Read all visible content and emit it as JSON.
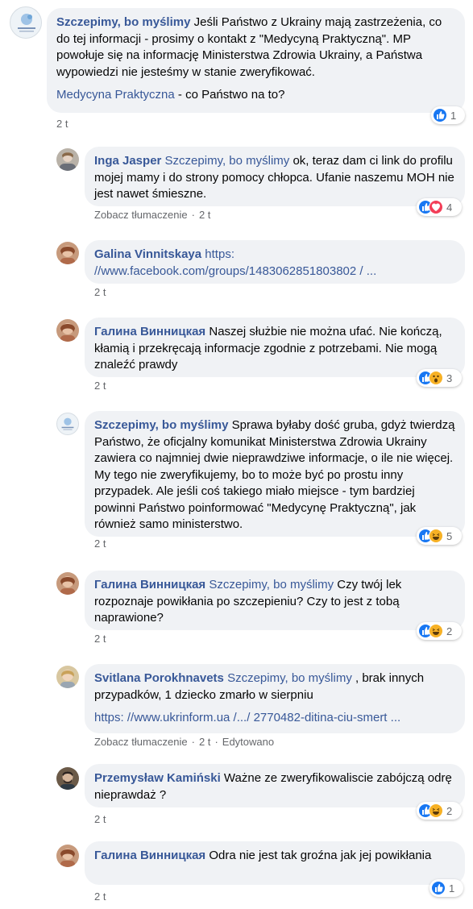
{
  "comments": [
    {
      "author": "Szczepimy, bo myślimy",
      "mention": "",
      "text": "Jeśli Państwo z Ukrainy mają zastrzeżenia, co do tej informacji - prosimy o kontakt z \"Medycyną Praktyczną\". MP powołuje się na informację Ministerstwa Zdrowia Ukrainy, a Państwa wypowiedzi nie jesteśmy w stanie zweryfikować.",
      "second_link": "Medycyna Praktyczna",
      "second_text": " - co Państwo na to?",
      "time": "2 t",
      "reaction_count": "1"
    },
    {
      "author": "Inga Jasper",
      "mention": "Szczepimy, bo myślimy",
      "text": " ok, teraz dam ci link do profilu mojej mamy i do strony pomocy chłopca. Ufanie naszemu MOH nie jest nawet śmieszne.",
      "translate": "Zobacz tłumaczenie",
      "time": "2 t",
      "reaction_count": "4"
    },
    {
      "author": "Galina Vinnitskaya",
      "link": "https: //www.facebook.com/groups/1483062851803802 / ...",
      "time": "2 t"
    },
    {
      "author": "Галина Винницкая",
      "text": " Naszej służbie nie można ufać. Nie kończą, kłamią i przekręcają informacje zgodnie z potrzebami. Nie mogą znaleźć prawdy",
      "time": "2 t",
      "reaction_count": "3"
    },
    {
      "author": "Szczepimy, bo myślimy",
      "text": " Sprawa byłaby dość gruba, gdyż twierdzą Państwo, że oficjalny komunikat Ministerstwa Zdrowia Ukrainy zawiera co najmniej dwie nieprawdziwe informacje, o ile nie więcej. My tego nie zweryfikujemy, bo to może być po prostu inny przypadek. Ale jeśli coś takiego miało miejsce - tym bardziej powinni Państwo poinformować \"Medycynę Praktyczną\", jak również samo ministerstwo.",
      "time": "2 t",
      "reaction_count": "5"
    },
    {
      "author": "Галина Винницкая",
      "mention": "Szczepimy, bo myślimy",
      "text": " Czy twój lek rozpoznaje powikłania po szczepieniu? Czy to jest z tobą naprawione?",
      "time": "2 t",
      "reaction_count": "2"
    },
    {
      "author": "Svitlana Porokhnavets",
      "mention": "Szczepimy, bo myślimy",
      "text": " , brak innych przypadków, 1 dziecko zmarło w sierpniu",
      "link": "https: //www.ukrinform.ua /.../ 2770482-ditina-ciu-smert ...",
      "translate": "Zobacz tłumaczenie",
      "time": "2 t",
      "edited": "Edytowano"
    },
    {
      "author": "Przemysław Kamiński",
      "text": " Ważne ze zweryfikowaliscie zabójczą odrę nieprawdaż ?",
      "time": "2 t",
      "reaction_count": "2"
    },
    {
      "author": "Галина Винницкая",
      "text": " Odra nie jest tak groźna jak jej powikłania",
      "time": "2 t",
      "reaction_count": "1"
    }
  ],
  "colors": {
    "bubble": "#f0f2f5",
    "author": "#385898",
    "meta": "#65676b",
    "like": "#1877f2",
    "love": "#f33e58",
    "haha": "#f7b125"
  }
}
